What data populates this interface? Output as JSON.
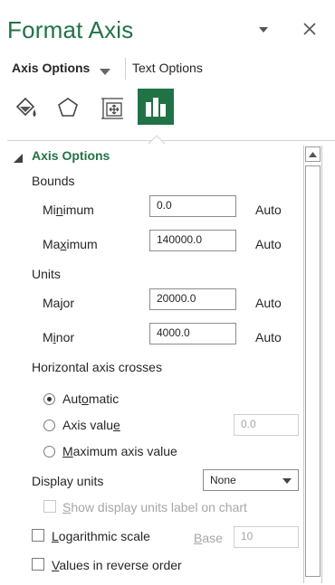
{
  "pane": {
    "title": "Format Axis",
    "dropdown_icon": "triangle-down-icon",
    "close_icon": "close-icon"
  },
  "tabs": {
    "axis_options": "Axis Options",
    "text_options": "Text Options"
  },
  "category_icons": [
    "fill-line-icon",
    "effects-pentagon-icon",
    "size-properties-icon",
    "axis-options-bar-icon"
  ],
  "section": {
    "title": "Axis Options"
  },
  "bounds": {
    "label": "Bounds",
    "minimum": {
      "label_pre": "Mi",
      "label_u": "n",
      "label_post": "imum",
      "value": "0.0",
      "auto": "Auto"
    },
    "maximum": {
      "label_pre": "Ma",
      "label_u": "x",
      "label_post": "imum",
      "value": "140000.0",
      "auto": "Auto"
    }
  },
  "units": {
    "label": "Units",
    "major": {
      "label": "Major",
      "value": "20000.0",
      "auto": "Auto"
    },
    "minor": {
      "label_pre": "M",
      "label_u": "i",
      "label_post": "nor",
      "value": "4000.0",
      "auto": "Auto"
    }
  },
  "crosses": {
    "label": "Horizontal axis crosses",
    "automatic": {
      "label_pre": "Aut",
      "label_u": "o",
      "label_post": "matic",
      "selected": true
    },
    "axis_value": {
      "label_pre": "Axis valu",
      "label_u": "e",
      "label_post": "",
      "value": "0.0",
      "selected": false
    },
    "max_value": {
      "label_pre": "",
      "label_u": "M",
      "label_post": "aximum axis value",
      "selected": false
    }
  },
  "display_units": {
    "label": "Display units",
    "selected": "None",
    "show_label_pre": "",
    "show_label_u": "S",
    "show_label_post": "how display units label on chart"
  },
  "log_scale": {
    "label_pre": "",
    "label_u": "L",
    "label_post": "ogarithmic scale",
    "base_pre": "",
    "base_u": "B",
    "base_post": "ase",
    "base_value": "10"
  },
  "reverse": {
    "label_pre": "",
    "label_u": "V",
    "label_post": "alues in reverse order"
  },
  "colors": {
    "accent": "#217346",
    "disabled_text": "#a6a6a6"
  }
}
